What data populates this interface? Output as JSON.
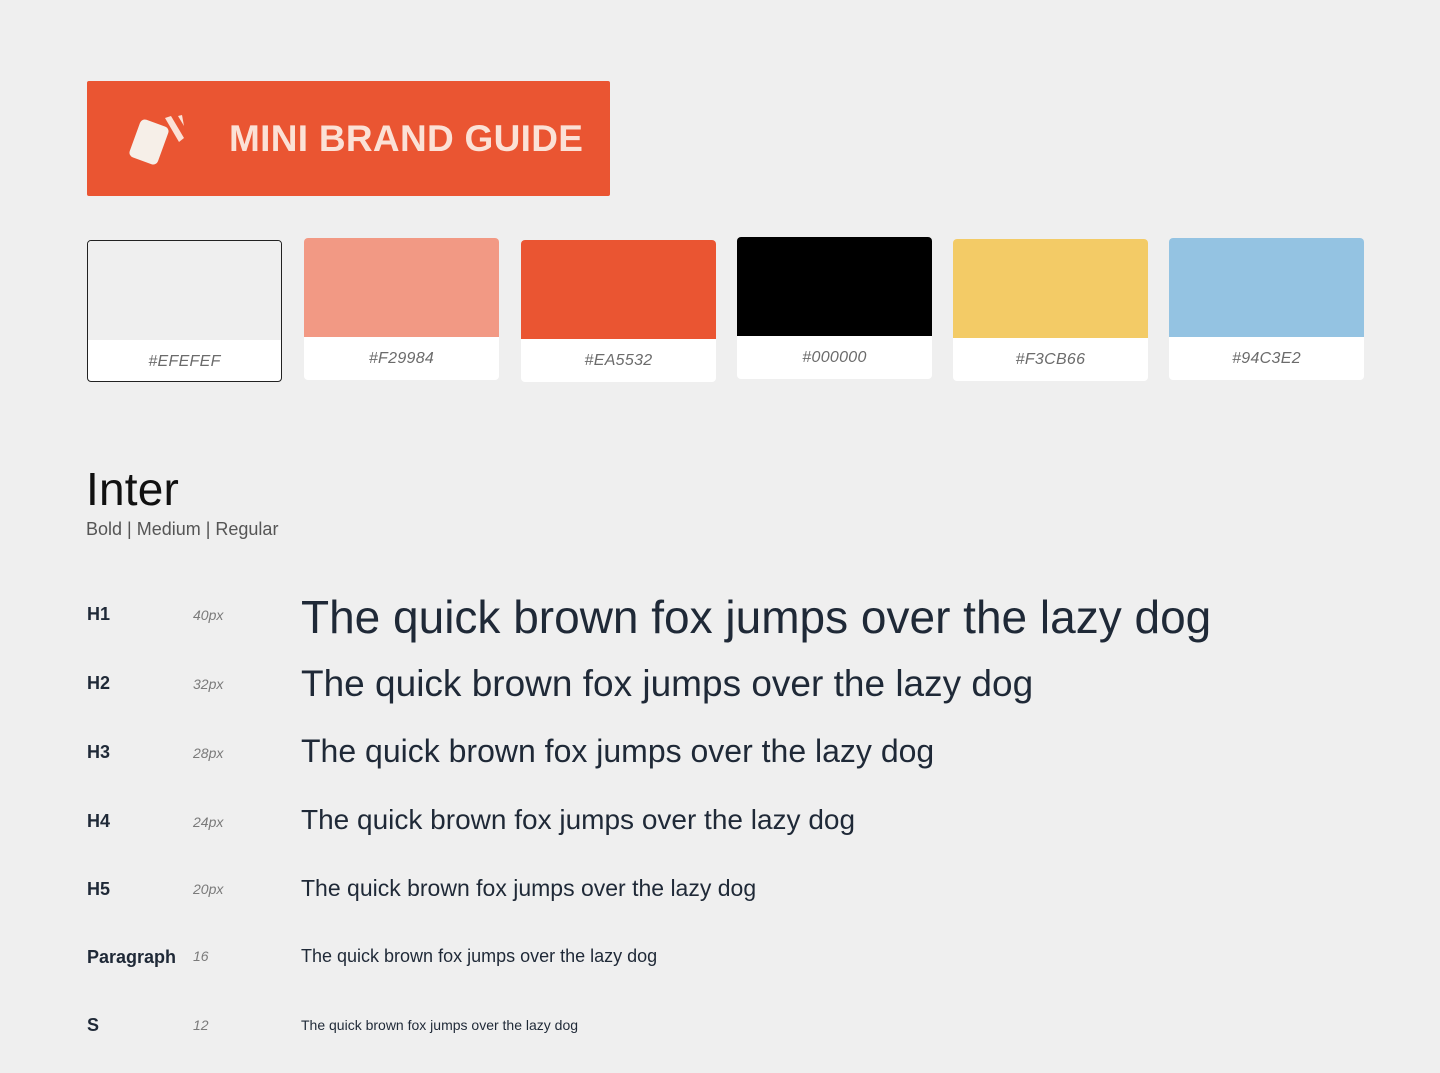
{
  "header": {
    "title": "MINI BRAND GUIDE",
    "logo_icon": "cards-logo-icon",
    "background": "#EA5532",
    "text_color": "#FBE1D6"
  },
  "palette": [
    {
      "hex": "#EFEFEF",
      "label": "#EFEFEF"
    },
    {
      "hex": "#F29984",
      "label": "#F29984"
    },
    {
      "hex": "#EA5532",
      "label": "#EA5532"
    },
    {
      "hex": "#000000",
      "label": "#000000"
    },
    {
      "hex": "#F3CB66",
      "label": "#F3CB66"
    },
    {
      "hex": "#94C3E2",
      "label": "#94C3E2"
    }
  ],
  "typography": {
    "font_name": "Inter",
    "weights": "Bold | Medium | Regular",
    "sample_text": "The quick brown fox jumps over the lazy dog",
    "scale": [
      {
        "tag": "H1",
        "size": "40px"
      },
      {
        "tag": "H2",
        "size": "32px"
      },
      {
        "tag": "H3",
        "size": "28px"
      },
      {
        "tag": "H4",
        "size": "24px"
      },
      {
        "tag": "H5",
        "size": "20px"
      },
      {
        "tag": "Paragraph",
        "size": "16"
      },
      {
        "tag": "S",
        "size": "12"
      }
    ]
  }
}
